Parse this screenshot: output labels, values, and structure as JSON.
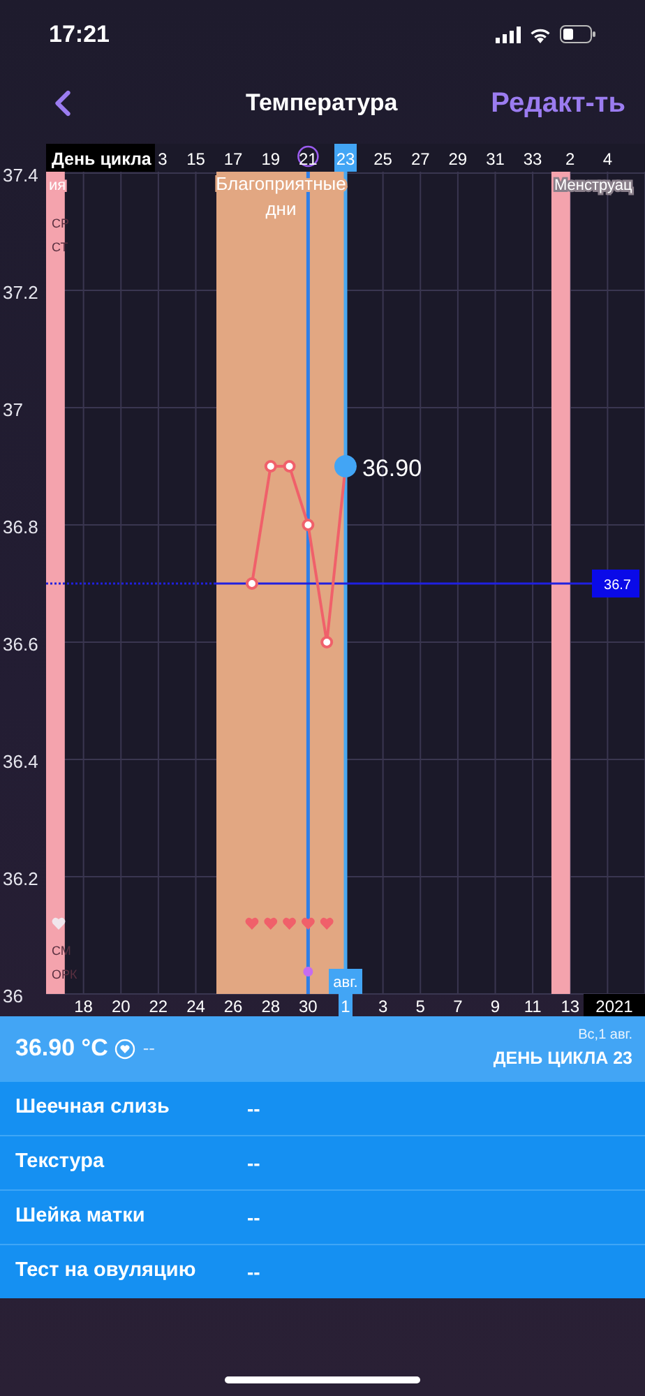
{
  "status_bar": {
    "time": "17:21"
  },
  "header": {
    "title": "Температура",
    "edit": "Редакт-ть"
  },
  "chart": {
    "axis_title": "День цикла",
    "extra_day_labels": [
      {
        "kind": "before",
        "text": "3"
      },
      {
        "kind": "after",
        "text": "2"
      },
      {
        "kind": "after",
        "text": "4"
      }
    ],
    "day_states": [
      {
        "selected": false,
        "marked": false
      },
      {
        "selected": false,
        "marked": false
      },
      {
        "selected": false,
        "marked": false
      },
      {
        "selected": false,
        "marked": true
      },
      {
        "selected": true,
        "marked": false
      },
      {
        "selected": false,
        "marked": false
      },
      {
        "selected": false,
        "marked": false
      },
      {
        "selected": false,
        "marked": false
      },
      {
        "selected": false,
        "marked": false
      },
      {
        "selected": false,
        "marked": false
      }
    ],
    "bottom_labels": [
      {
        "text": "18",
        "selected": false
      },
      {
        "text": "20",
        "selected": false
      },
      {
        "text": "22",
        "selected": false
      },
      {
        "text": "24",
        "selected": false
      },
      {
        "text": "26",
        "selected": false
      },
      {
        "text": "28",
        "selected": false
      },
      {
        "text": "30",
        "selected": false
      },
      {
        "text": "1",
        "selected": true
      },
      {
        "text": "3",
        "selected": false
      },
      {
        "text": "5",
        "selected": false
      },
      {
        "text": "7",
        "selected": false
      },
      {
        "text": "9",
        "selected": false
      },
      {
        "text": "11",
        "selected": false
      },
      {
        "text": "13",
        "selected": false
      }
    ],
    "month_tag": "авг.",
    "year": "2021",
    "row_labels": [
      {
        "kind": "text",
        "text": "СР"
      },
      {
        "kind": "text",
        "text": "СТ"
      },
      {
        "kind": "heart"
      },
      {
        "kind": "text",
        "text": "СМ"
      },
      {
        "kind": "text",
        "text": "ОРК"
      }
    ],
    "markers": [
      {
        "kind": "heart"
      },
      {
        "kind": "heart"
      },
      {
        "kind": "heart"
      },
      {
        "kind": "heart"
      },
      {
        "kind": "heart"
      }
    ],
    "selected_reading": "36.90",
    "chart_data": {
      "type": "line",
      "x": [
        18,
        19,
        20,
        21,
        22,
        23
      ],
      "series": [
        {
          "color": "#f0606a",
          "marker": "o",
          "values": [
            36.7,
            36.9,
            36.9,
            36.8,
            36.6,
            36.9
          ]
        }
      ],
      "xlim": [
        7,
        39
      ],
      "ylim": [
        36,
        37.4
      ],
      "grid": true,
      "xticks": [
        15,
        17,
        19,
        21,
        23,
        25,
        27,
        29,
        31,
        33
      ],
      "yticks": [
        36,
        36.2,
        36.4,
        36.6,
        36.8,
        37,
        37.2,
        37.4
      ],
      "bands": [
        {
          "axis": "x",
          "from": 7,
          "to": 8,
          "label": "ия",
          "color": "#f4a3ad"
        },
        {
          "axis": "x",
          "from": 16.1,
          "to": 23,
          "label": "Благоприятные дни",
          "color": "#e2a782"
        },
        {
          "axis": "x",
          "from": 34,
          "to": 35,
          "label": "Менструац",
          "color": "#f4a3ad"
        }
      ],
      "ref_lines": [
        {
          "axis": "y",
          "value": 36.7,
          "label": "36.7",
          "color": "#2020e0"
        },
        {
          "axis": "x",
          "value": 21,
          "color": "#2f7fe8"
        },
        {
          "axis": "x",
          "value": 23,
          "color": "#4aa8f0"
        }
      ]
    }
  },
  "summary": {
    "temperature": "36.90 °C",
    "note": "--",
    "date": "Вс,1 авг.",
    "cycle_day": "ДЕНЬ ЦИКЛА 23"
  },
  "rows": [
    {
      "label": "Шеечная слизь",
      "value": "--"
    },
    {
      "label": "Текстура",
      "value": "--"
    },
    {
      "label": "Шейка матки",
      "value": "--"
    },
    {
      "label": "Тест на овуляцию",
      "value": "--"
    }
  ]
}
